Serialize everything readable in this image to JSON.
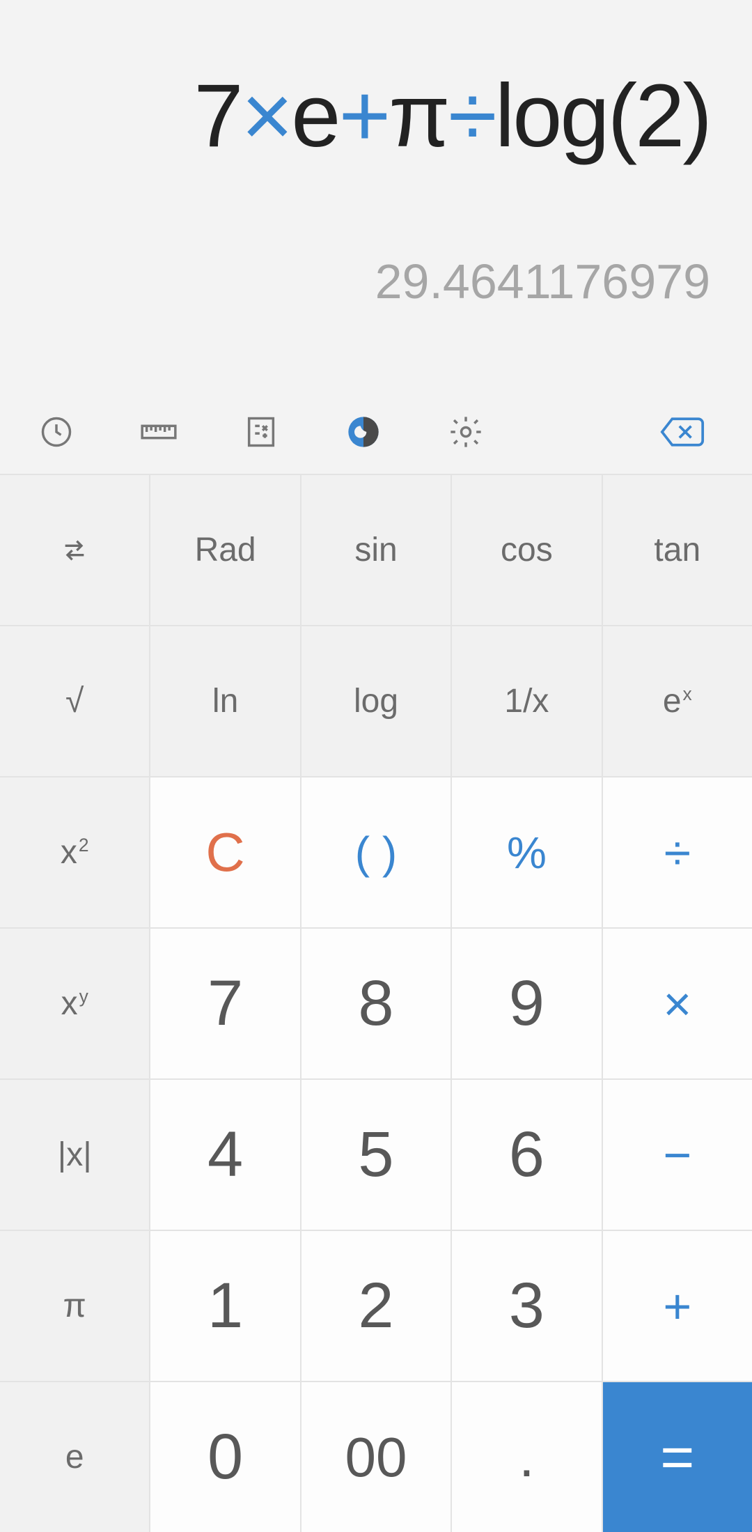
{
  "display": {
    "expression_tokens": [
      {
        "t": "7",
        "op": false
      },
      {
        "t": "×",
        "op": true
      },
      {
        "t": "e",
        "op": false
      },
      {
        "t": "+",
        "op": true
      },
      {
        "t": "π",
        "op": false
      },
      {
        "t": "÷",
        "op": true
      },
      {
        "t": "log(2)",
        "op": false
      }
    ],
    "result": "29.4641176979"
  },
  "toolbar": {
    "history_icon": "history-icon",
    "ruler_icon": "ruler-icon",
    "calc_mode_icon": "calc-mode-icon",
    "theme_icon": "theme-icon",
    "settings_icon": "settings-icon",
    "backspace_icon": "backspace-icon"
  },
  "keys": {
    "swap": "⇆",
    "rad": "Rad",
    "sin": "sin",
    "cos": "cos",
    "tan": "tan",
    "sqrt": "√",
    "ln": "ln",
    "log": "log",
    "inv": "1/x",
    "ex_base": "e",
    "ex_sup": "x",
    "x2_base": "x",
    "x2_sup": "2",
    "clear": "C",
    "paren": "( )",
    "percent": "%",
    "divide": "÷",
    "xy_base": "x",
    "xy_sup": "y",
    "k7": "7",
    "k8": "8",
    "k9": "9",
    "multiply": "×",
    "abs": "|x|",
    "k4": "4",
    "k5": "5",
    "k6": "6",
    "minus": "−",
    "pi": "π",
    "k1": "1",
    "k2": "2",
    "k3": "3",
    "plus": "+",
    "e": "e",
    "k0": "0",
    "k00": "00",
    "dot": ".",
    "equals": "="
  },
  "colors": {
    "accent": "#3a86d0",
    "clear": "#e0704b",
    "digit": "#585858",
    "sci_bg": "#f1f1f1",
    "num_bg": "#fdfdfd"
  }
}
